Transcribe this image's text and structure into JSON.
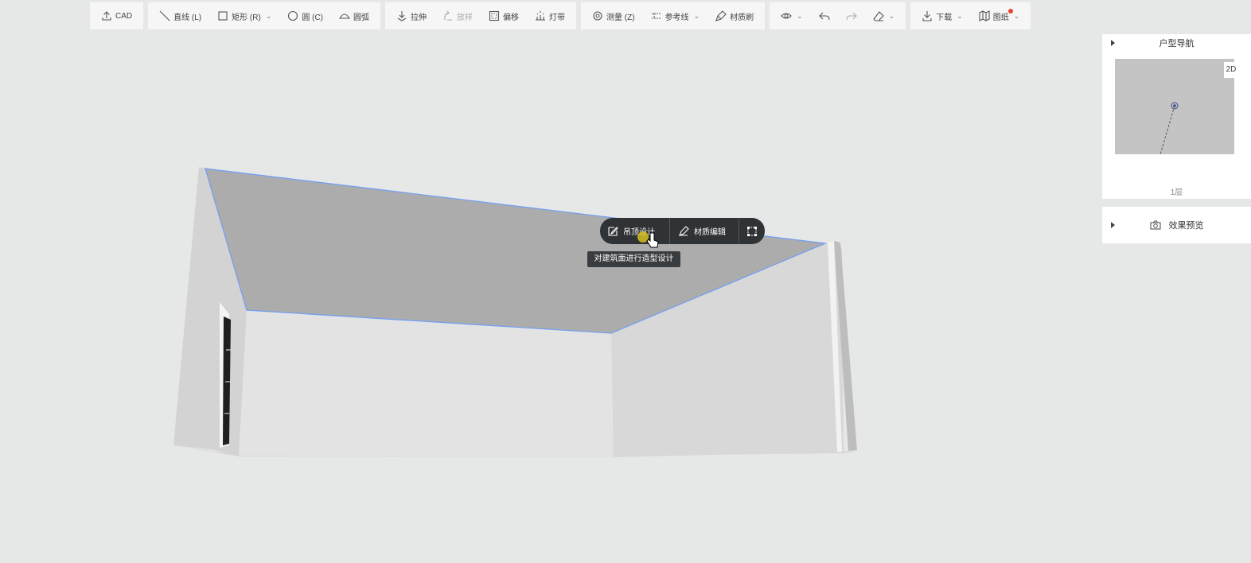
{
  "toolbar": {
    "cad": "CAD",
    "line": "直线 (L)",
    "rect": "矩形 (R)",
    "circle": "圆 (C)",
    "arc": "圆弧",
    "extrude": "拉伸",
    "rotate": "放样",
    "offset": "偏移",
    "lightstrip": "灯带",
    "measure": "测量 (Z)",
    "guideline": "参考线",
    "material_brush": "材质刷",
    "download": "下载",
    "drawings": "图纸"
  },
  "right_panel": {
    "nav_title": "户型导航",
    "minimap_badge": "2D",
    "floor_label": "1层",
    "preview_title": "效果预览"
  },
  "context_menu": {
    "ceiling_design": "吊顶设计",
    "material_edit": "材质编辑"
  },
  "tooltip": "对建筑面进行造型设计",
  "colors": {
    "toolbar_bg": "#f6f6f6",
    "canvas_bg": "#e6e7e7",
    "selection_edge": "#6f9ef5",
    "menu_bg": "#2f3335",
    "notify_dot": "#e8442e"
  }
}
